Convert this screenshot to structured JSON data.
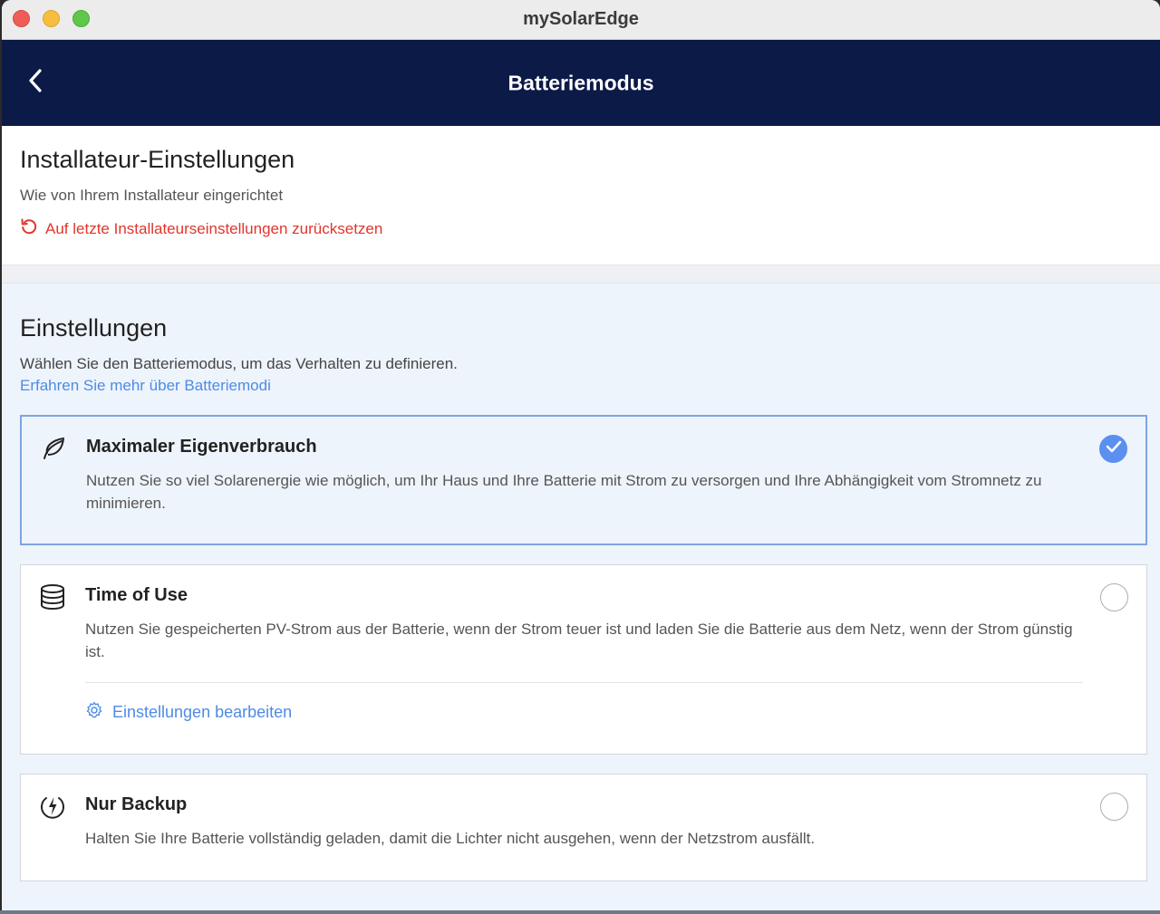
{
  "app": {
    "title": "mySolarEdge"
  },
  "navbar": {
    "title": "Batteriemodus"
  },
  "installer": {
    "heading": "Installateur-Einstellungen",
    "subtitle": "Wie von Ihrem Installateur eingerichtet",
    "reset_label": "Auf letzte Installateurseinstellungen zurücksetzen"
  },
  "settings": {
    "heading": "Einstellungen",
    "subtitle": "Wählen Sie den Batteriemodus, um das Verhalten zu definieren.",
    "learn_more": "Erfahren Sie mehr über Batteriemodi",
    "modes": [
      {
        "icon": "leaf-icon",
        "title": "Maximaler Eigenverbrauch",
        "description": "Nutzen Sie so viel Solarenergie wie möglich, um Ihr Haus und Ihre Batterie mit Strom zu versorgen und Ihre Abhängigkeit vom Stromnetz zu minimieren.",
        "selected": true
      },
      {
        "icon": "database-icon",
        "title": "Time of Use",
        "description": "Nutzen Sie gespeicherten PV-Strom aus der Batterie, wenn der Strom teuer ist und laden Sie die Batterie aus dem Netz, wenn der Strom günstig ist.",
        "edit_label": "Einstellungen bearbeiten",
        "selected": false
      },
      {
        "icon": "power-bolt-icon",
        "title": "Nur Backup",
        "description": "Halten Sie Ihre Batterie vollständig geladen, damit die Lichter nicht ausgehen, wenn der Netzstrom ausfällt.",
        "selected": false
      }
    ]
  },
  "colors": {
    "navbar": "#0b1a47",
    "accent": "#5b8ff0",
    "link": "#4f8be3",
    "reset": "#e0362c"
  }
}
